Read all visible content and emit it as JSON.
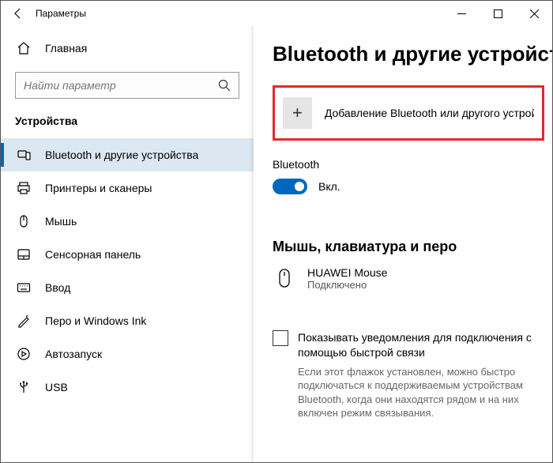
{
  "titlebar": {
    "title": "Параметры"
  },
  "sidebar": {
    "home": "Главная",
    "search_placeholder": "Найти параметр",
    "category": "Устройства",
    "items": [
      {
        "label": "Bluetooth и другие устройства",
        "selected": true
      },
      {
        "label": "Принтеры и сканеры"
      },
      {
        "label": "Мышь"
      },
      {
        "label": "Сенсорная панель"
      },
      {
        "label": "Ввод"
      },
      {
        "label": "Перо и Windows Ink"
      },
      {
        "label": "Автозапуск"
      },
      {
        "label": "USB"
      }
    ]
  },
  "main": {
    "heading": "Bluetooth и другие устройства",
    "add_device": "Добавление Bluetooth или другого устройс...",
    "bluetooth_label": "Bluetooth",
    "bluetooth_state": "Вкл.",
    "section_heading": "Мышь, клавиатура и перо",
    "device": {
      "name": "HUAWEI  Mouse",
      "status": "Подключено"
    },
    "checkbox_label": "Показывать уведомления для подключения с помощью быстрой связи",
    "help_text": "Если этот флажок установлен, можно быстро подключаться к поддерживаемым устройствам Bluetooth, когда они находятся рядом и на них включен режим связывания."
  }
}
